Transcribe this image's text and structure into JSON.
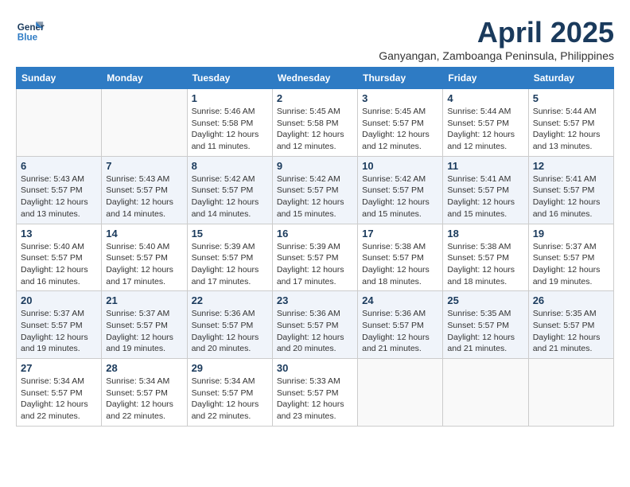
{
  "logo": {
    "line1": "General",
    "line2": "Blue"
  },
  "title": "April 2025",
  "subtitle": "Ganyangan, Zamboanga Peninsula, Philippines",
  "headers": [
    "Sunday",
    "Monday",
    "Tuesday",
    "Wednesday",
    "Thursday",
    "Friday",
    "Saturday"
  ],
  "weeks": [
    [
      {
        "num": "",
        "info": ""
      },
      {
        "num": "",
        "info": ""
      },
      {
        "num": "1",
        "info": "Sunrise: 5:46 AM\nSunset: 5:58 PM\nDaylight: 12 hours and 11 minutes."
      },
      {
        "num": "2",
        "info": "Sunrise: 5:45 AM\nSunset: 5:58 PM\nDaylight: 12 hours and 12 minutes."
      },
      {
        "num": "3",
        "info": "Sunrise: 5:45 AM\nSunset: 5:57 PM\nDaylight: 12 hours and 12 minutes."
      },
      {
        "num": "4",
        "info": "Sunrise: 5:44 AM\nSunset: 5:57 PM\nDaylight: 12 hours and 12 minutes."
      },
      {
        "num": "5",
        "info": "Sunrise: 5:44 AM\nSunset: 5:57 PM\nDaylight: 12 hours and 13 minutes."
      }
    ],
    [
      {
        "num": "6",
        "info": "Sunrise: 5:43 AM\nSunset: 5:57 PM\nDaylight: 12 hours and 13 minutes."
      },
      {
        "num": "7",
        "info": "Sunrise: 5:43 AM\nSunset: 5:57 PM\nDaylight: 12 hours and 14 minutes."
      },
      {
        "num": "8",
        "info": "Sunrise: 5:42 AM\nSunset: 5:57 PM\nDaylight: 12 hours and 14 minutes."
      },
      {
        "num": "9",
        "info": "Sunrise: 5:42 AM\nSunset: 5:57 PM\nDaylight: 12 hours and 15 minutes."
      },
      {
        "num": "10",
        "info": "Sunrise: 5:42 AM\nSunset: 5:57 PM\nDaylight: 12 hours and 15 minutes."
      },
      {
        "num": "11",
        "info": "Sunrise: 5:41 AM\nSunset: 5:57 PM\nDaylight: 12 hours and 15 minutes."
      },
      {
        "num": "12",
        "info": "Sunrise: 5:41 AM\nSunset: 5:57 PM\nDaylight: 12 hours and 16 minutes."
      }
    ],
    [
      {
        "num": "13",
        "info": "Sunrise: 5:40 AM\nSunset: 5:57 PM\nDaylight: 12 hours and 16 minutes."
      },
      {
        "num": "14",
        "info": "Sunrise: 5:40 AM\nSunset: 5:57 PM\nDaylight: 12 hours and 17 minutes."
      },
      {
        "num": "15",
        "info": "Sunrise: 5:39 AM\nSunset: 5:57 PM\nDaylight: 12 hours and 17 minutes."
      },
      {
        "num": "16",
        "info": "Sunrise: 5:39 AM\nSunset: 5:57 PM\nDaylight: 12 hours and 17 minutes."
      },
      {
        "num": "17",
        "info": "Sunrise: 5:38 AM\nSunset: 5:57 PM\nDaylight: 12 hours and 18 minutes."
      },
      {
        "num": "18",
        "info": "Sunrise: 5:38 AM\nSunset: 5:57 PM\nDaylight: 12 hours and 18 minutes."
      },
      {
        "num": "19",
        "info": "Sunrise: 5:37 AM\nSunset: 5:57 PM\nDaylight: 12 hours and 19 minutes."
      }
    ],
    [
      {
        "num": "20",
        "info": "Sunrise: 5:37 AM\nSunset: 5:57 PM\nDaylight: 12 hours and 19 minutes."
      },
      {
        "num": "21",
        "info": "Sunrise: 5:37 AM\nSunset: 5:57 PM\nDaylight: 12 hours and 19 minutes."
      },
      {
        "num": "22",
        "info": "Sunrise: 5:36 AM\nSunset: 5:57 PM\nDaylight: 12 hours and 20 minutes."
      },
      {
        "num": "23",
        "info": "Sunrise: 5:36 AM\nSunset: 5:57 PM\nDaylight: 12 hours and 20 minutes."
      },
      {
        "num": "24",
        "info": "Sunrise: 5:36 AM\nSunset: 5:57 PM\nDaylight: 12 hours and 21 minutes."
      },
      {
        "num": "25",
        "info": "Sunrise: 5:35 AM\nSunset: 5:57 PM\nDaylight: 12 hours and 21 minutes."
      },
      {
        "num": "26",
        "info": "Sunrise: 5:35 AM\nSunset: 5:57 PM\nDaylight: 12 hours and 21 minutes."
      }
    ],
    [
      {
        "num": "27",
        "info": "Sunrise: 5:34 AM\nSunset: 5:57 PM\nDaylight: 12 hours and 22 minutes."
      },
      {
        "num": "28",
        "info": "Sunrise: 5:34 AM\nSunset: 5:57 PM\nDaylight: 12 hours and 22 minutes."
      },
      {
        "num": "29",
        "info": "Sunrise: 5:34 AM\nSunset: 5:57 PM\nDaylight: 12 hours and 22 minutes."
      },
      {
        "num": "30",
        "info": "Sunrise: 5:33 AM\nSunset: 5:57 PM\nDaylight: 12 hours and 23 minutes."
      },
      {
        "num": "",
        "info": ""
      },
      {
        "num": "",
        "info": ""
      },
      {
        "num": "",
        "info": ""
      }
    ]
  ]
}
